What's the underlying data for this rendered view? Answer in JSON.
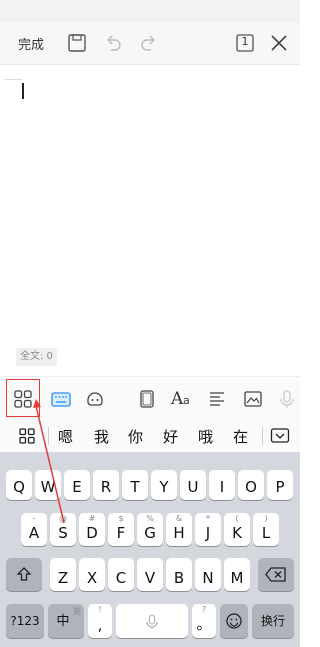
{
  "toolbar": {
    "done_label": "完成",
    "page_count": "1"
  },
  "editor": {
    "word_count": "全文: 0"
  },
  "format_toolbar": {
    "icons": [
      "apps-grid-icon",
      "keyboard-icon",
      "emoji-icon",
      "page-frame-icon",
      "font-style-icon",
      "align-icon",
      "image-icon",
      "mic-icon"
    ]
  },
  "candidates": {
    "words": [
      "嗯",
      "我",
      "你",
      "好",
      "哦",
      "在"
    ]
  },
  "keyboard": {
    "row1": [
      "Q",
      "W",
      "E",
      "R",
      "T",
      "Y",
      "U",
      "I",
      "O",
      "P"
    ],
    "row2": [
      "A",
      "S",
      "D",
      "F",
      "G",
      "H",
      "J",
      "K",
      "L"
    ],
    "row2_sub": [
      "-",
      "@",
      "#",
      "$",
      "%",
      "&",
      "*",
      "(",
      ")"
    ],
    "row3": [
      "Z",
      "X",
      "C",
      "V",
      "B",
      "N",
      "M"
    ],
    "row3_sub": [
      "",
      "",
      "",
      "",
      "",
      "",
      ""
    ],
    "numbers_label": "?123",
    "lang_label": "中",
    "lang_sub": "英",
    "comma_label": ",",
    "comma_sub": "!",
    "period_label": "。",
    "period_sub": "?",
    "enter_label": "换行"
  },
  "colors": {
    "highlight": "#e23b3b",
    "keyboard_bg": "#d4d7dd",
    "accent_blue": "#2a8cf0"
  }
}
